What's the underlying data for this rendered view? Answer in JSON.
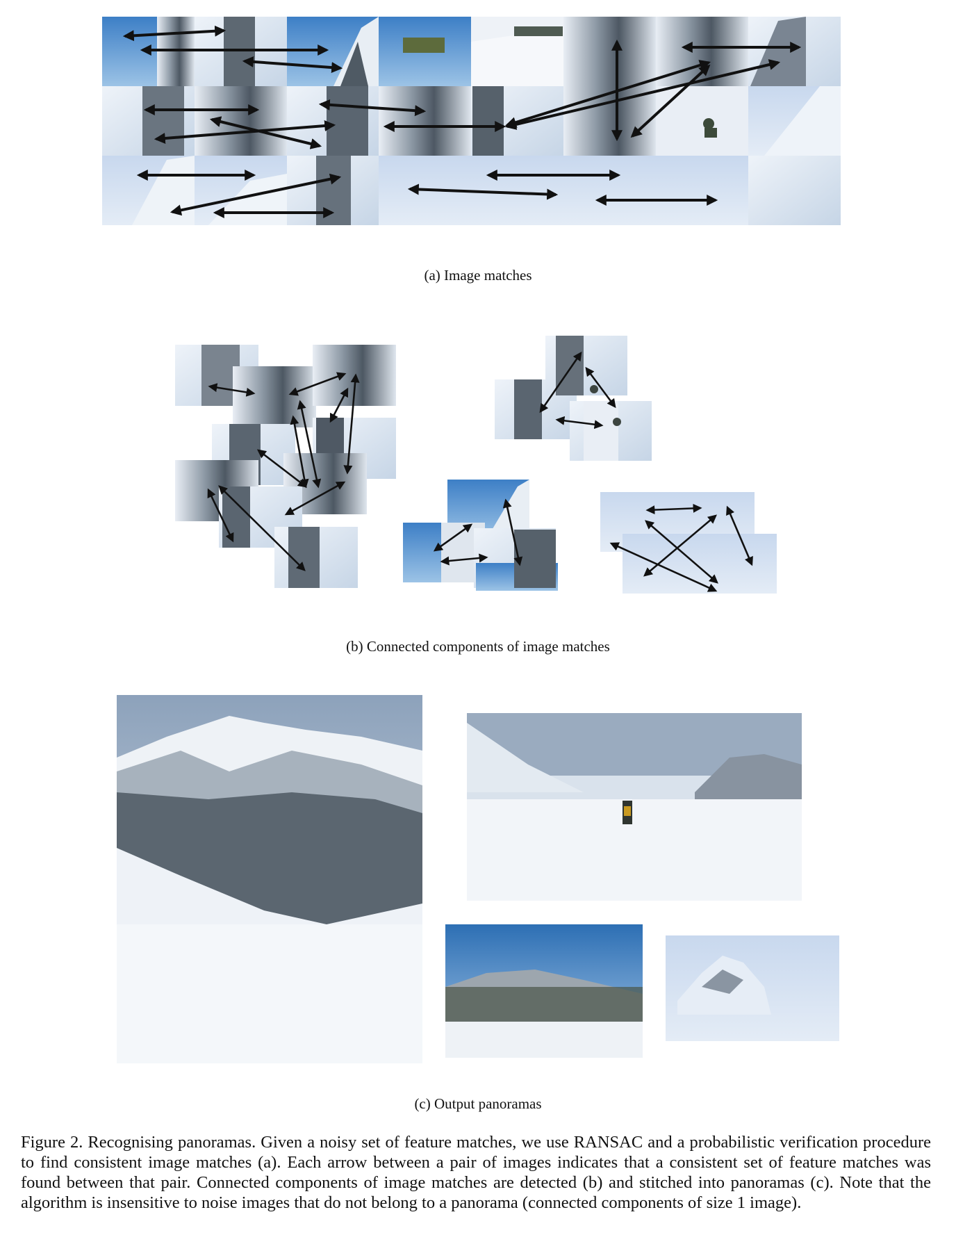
{
  "panel_a": {
    "label": "(a) Image matches"
  },
  "panel_b": {
    "label": "(b) Connected components of image matches"
  },
  "panel_c": {
    "label": "(c) Output panoramas"
  },
  "figure_caption": "Figure 2. Recognising panoramas. Given a noisy set of feature matches, we use RANSAC and a probabilistic verification procedure to find consistent image matches (a). Each arrow between a pair of images indicates that a consistent set of feature matches was found between that pair. Connected components of image matches are detected (b) and stitched into panoramas (c). Note that the algorithm is insensitive to noise images that do not belong to a panorama (connected components of size 1 image)."
}
